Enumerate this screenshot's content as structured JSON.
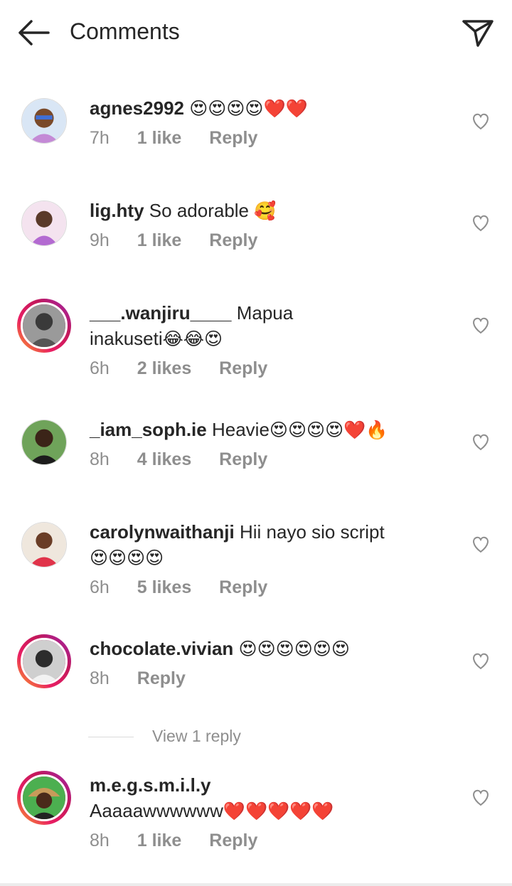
{
  "header": {
    "title": "Comments"
  },
  "comments": [
    {
      "username": "agnes2992",
      "text": "",
      "emoji": "😍😍😍😍❤️❤️",
      "time": "7h",
      "likes": "1 like",
      "reply": "Reply"
    },
    {
      "username": "lig.hty",
      "text": "So adorable",
      "emoji": "🥰",
      "time": "9h",
      "likes": "1 like",
      "reply": "Reply"
    },
    {
      "username": "___.wanjiru____",
      "text": "Mapua",
      "text2": "inakuseti",
      "emoji": "😂😂😍",
      "time": "6h",
      "likes": "2 likes",
      "reply": "Reply"
    },
    {
      "username": "_iam_soph.ie",
      "text": "Heavie",
      "emoji": "😍😍😍😍❤️🔥",
      "time": "8h",
      "likes": "4 likes",
      "reply": "Reply"
    },
    {
      "username": "carolynwaithanji",
      "text": "Hii nayo sio script",
      "emoji": "😍😍😍😍",
      "time": "6h",
      "likes": "5 likes",
      "reply": "Reply"
    },
    {
      "username": "chocolate.vivian",
      "text": "",
      "emoji": "😍😍😍😍😍😍",
      "time": "8h",
      "likes": "",
      "reply": "Reply"
    },
    {
      "username": "m.e.g.s.m.i.l.y",
      "text": "Aaaaawwwwww",
      "emoji": "❤️❤️❤️❤️❤️",
      "time": "8h",
      "likes": "1 like",
      "reply": "Reply"
    }
  ],
  "view_replies": "View 1 reply",
  "icons": {
    "back": "arrow-left-icon",
    "send": "paper-plane-icon",
    "like": "heart-outline-icon"
  },
  "colors": {
    "text": "#262626",
    "meta": "#8e8e8e",
    "story_ring": "#e91e63"
  }
}
